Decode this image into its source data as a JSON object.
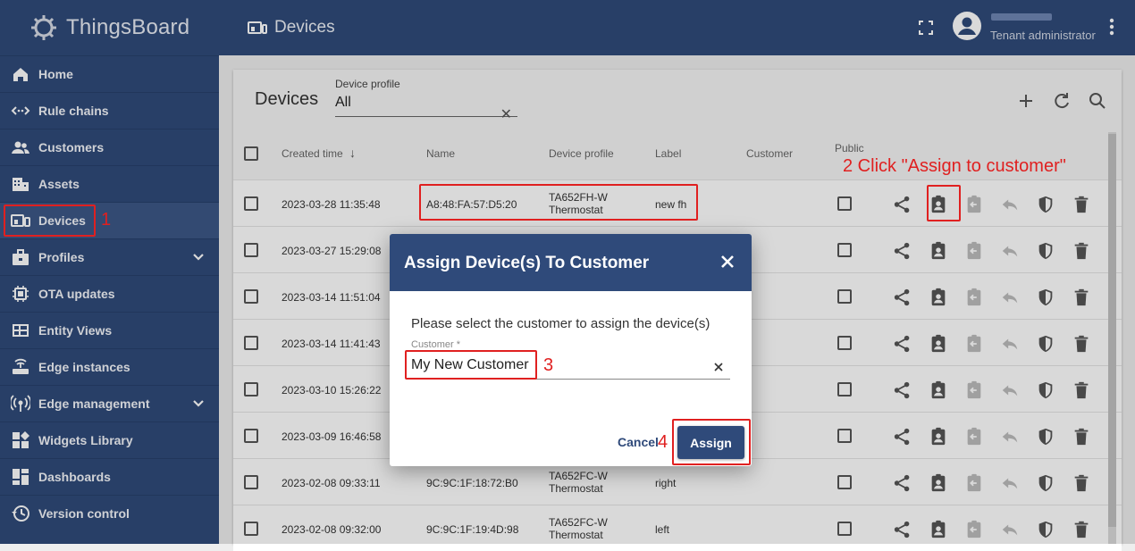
{
  "app": {
    "name": "ThingsBoard"
  },
  "topbar": {
    "title": "Devices",
    "user_name": "",
    "user_role": "Tenant administrator"
  },
  "sidebar": {
    "items": [
      {
        "label": "Home",
        "icon": "home-icon"
      },
      {
        "label": "Rule chains",
        "icon": "rule-chains-icon"
      },
      {
        "label": "Customers",
        "icon": "customers-icon"
      },
      {
        "label": "Assets",
        "icon": "assets-icon"
      },
      {
        "label": "Devices",
        "icon": "devices-icon",
        "active": true
      },
      {
        "label": "Profiles",
        "icon": "profiles-icon",
        "expandable": true
      },
      {
        "label": "OTA updates",
        "icon": "ota-icon"
      },
      {
        "label": "Entity Views",
        "icon": "entity-views-icon"
      },
      {
        "label": "Edge instances",
        "icon": "edge-instances-icon"
      },
      {
        "label": "Edge management",
        "icon": "edge-management-icon",
        "expandable": true
      },
      {
        "label": "Widgets Library",
        "icon": "widgets-icon"
      },
      {
        "label": "Dashboards",
        "icon": "dashboards-icon"
      },
      {
        "label": "Version control",
        "icon": "version-control-icon"
      }
    ]
  },
  "devices_card": {
    "title": "Devices",
    "device_profile_label": "Device profile",
    "device_profile_value": "All",
    "columns": [
      "Created time",
      "Name",
      "Device profile",
      "Label",
      "Customer",
      "Public"
    ]
  },
  "table": {
    "rows": [
      {
        "created": "2023-03-28 11:35:48",
        "name": "A8:48:FA:57:D5:20",
        "profile": "TA652FH-W Thermostat",
        "label": "new fh",
        "customer": ""
      },
      {
        "created": "2023-03-27 15:29:08",
        "name": "",
        "profile": "",
        "label": "",
        "customer": ""
      },
      {
        "created": "2023-03-14 11:51:04",
        "name": "",
        "profile": "",
        "label": "",
        "customer": ""
      },
      {
        "created": "2023-03-14 11:41:43",
        "name": "",
        "profile": "",
        "label": "",
        "customer": ""
      },
      {
        "created": "2023-03-10 15:26:22",
        "name": "",
        "profile": "",
        "label": "",
        "customer": ""
      },
      {
        "created": "2023-03-09 16:46:58",
        "name": "",
        "profile": "",
        "label": "",
        "customer": ""
      },
      {
        "created": "2023-02-08 09:33:11",
        "name": "9C:9C:1F:18:72:B0",
        "profile": "TA652FC-W Thermostat",
        "label": "right",
        "customer": ""
      },
      {
        "created": "2023-02-08 09:32:00",
        "name": "9C:9C:1F:19:4D:98",
        "profile": "TA652FC-W Thermostat",
        "label": "left",
        "customer": ""
      }
    ]
  },
  "dialog": {
    "title": "Assign Device(s) To Customer",
    "prompt": "Please select the customer to assign the device(s)",
    "customer_label": "Customer *",
    "customer_value": "My New Customer",
    "cancel_label": "Cancel",
    "assign_label": "Assign"
  },
  "annotations": {
    "step1": "1",
    "step2": "2 Click \"Assign to customer\"",
    "step3": "3",
    "step4": "4"
  },
  "colors": {
    "primary": "#2f4a7a",
    "annotation": "#e02020"
  }
}
